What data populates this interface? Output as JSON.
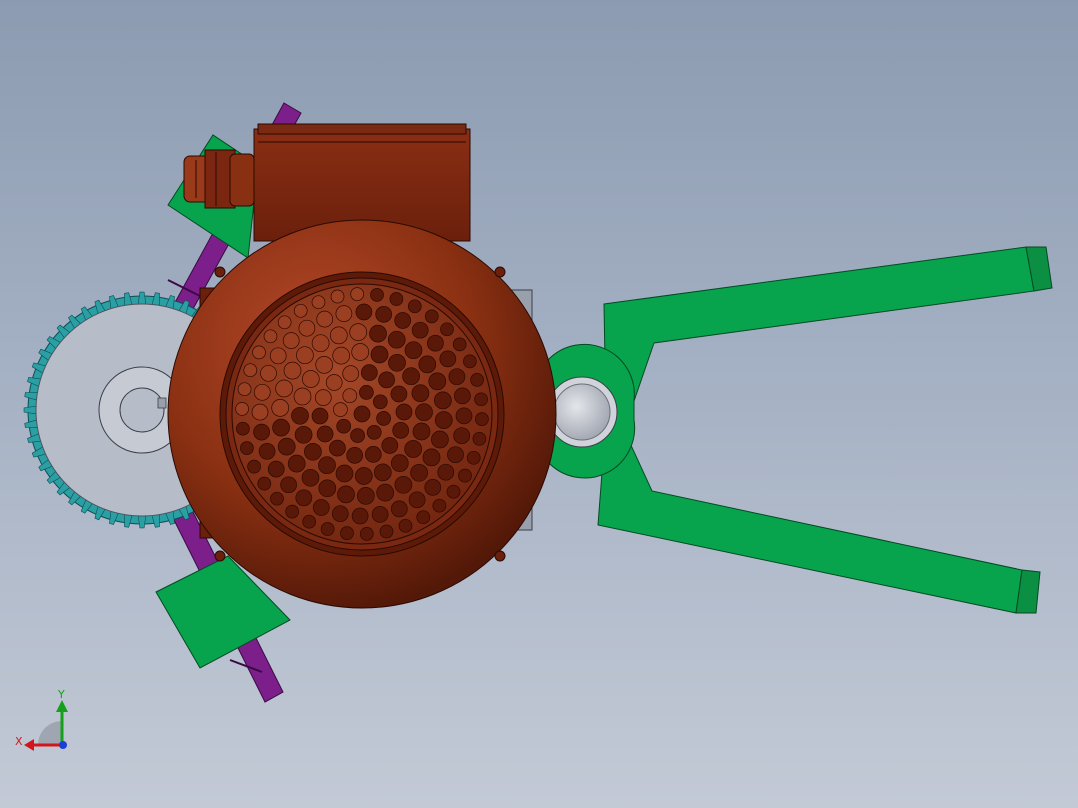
{
  "colors": {
    "background_top": "#8c9bb1",
    "background_bottom": "#c3cad6",
    "motor_body": "#8a3012",
    "motor_dark": "#4a1406",
    "gripper_arm": "#07a34d",
    "gear": "#2aa0a4",
    "gear_face": "#b7bcc9",
    "shaft": "#7d1f8a",
    "axis_x": "#d3161b",
    "axis_y": "#14a01a",
    "axis_z": "#1c3fd6"
  },
  "triad": {
    "x_label": "X",
    "y_label": "Y"
  }
}
